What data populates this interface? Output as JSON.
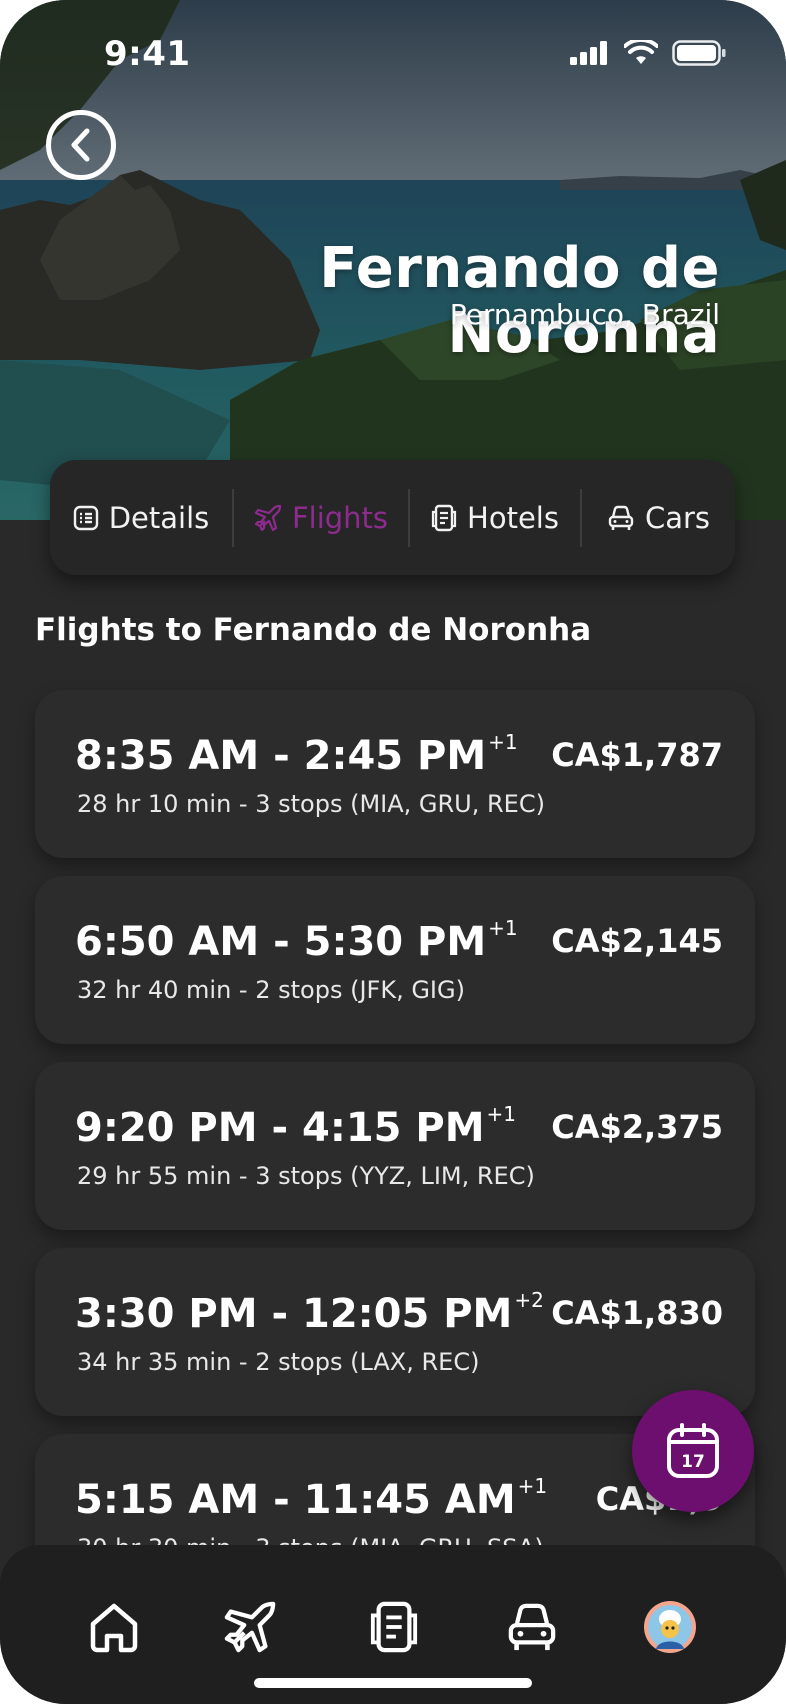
{
  "status_bar": {
    "time": "9:41",
    "icons": [
      "signal-icon",
      "wifi-icon",
      "battery-icon"
    ]
  },
  "destination": {
    "title": "Fernando de Noronha",
    "subtitle": "Pernambuco, Brazil"
  },
  "tabs": [
    {
      "label": "Details",
      "icon": "list-icon",
      "active": false
    },
    {
      "label": "Flights",
      "icon": "plane-icon",
      "active": true
    },
    {
      "label": "Hotels",
      "icon": "hotel-icon",
      "active": false
    },
    {
      "label": "Cars",
      "icon": "car-icon",
      "active": false
    }
  ],
  "section_title": "Flights to Fernando de Noronha",
  "flights": [
    {
      "times": "8:35 AM - 2:45 PM",
      "day_offset": "+1",
      "details": "28 hr  10 min - 3 stops (MIA, GRU, REC)",
      "price": "CA$1,787"
    },
    {
      "times": "6:50 AM - 5:30 PM",
      "day_offset": "+1",
      "details": "32 hr  40 min - 2 stops (JFK, GIG)",
      "price": "CA$2,145"
    },
    {
      "times": "9:20 PM - 4:15 PM",
      "day_offset": "+1",
      "details": "29 hr  55 min - 3 stops (YYZ, LIM, REC)",
      "price": "CA$2,375"
    },
    {
      "times": "3:30 PM - 12:05 PM",
      "day_offset": "+2",
      "details": "34 hr  35 min - 2 stops (LAX, REC)",
      "price": "CA$1,830"
    },
    {
      "times": "5:15 AM - 11:45 AM",
      "day_offset": "+1",
      "details": "30 hr  30 min - 3 stops (MIA, GRU, SSA)",
      "price": "CA$1,9"
    }
  ],
  "fab": {
    "icon": "calendar-icon",
    "day": "17"
  },
  "bottom_nav": [
    "home-icon",
    "plane-icon",
    "hotel-icon",
    "car-icon",
    "avatar"
  ],
  "colors": {
    "accent": "#6d0f6f",
    "active_tab": "#8d2b8e",
    "background": "#292929",
    "card": "#2c2c2c"
  }
}
